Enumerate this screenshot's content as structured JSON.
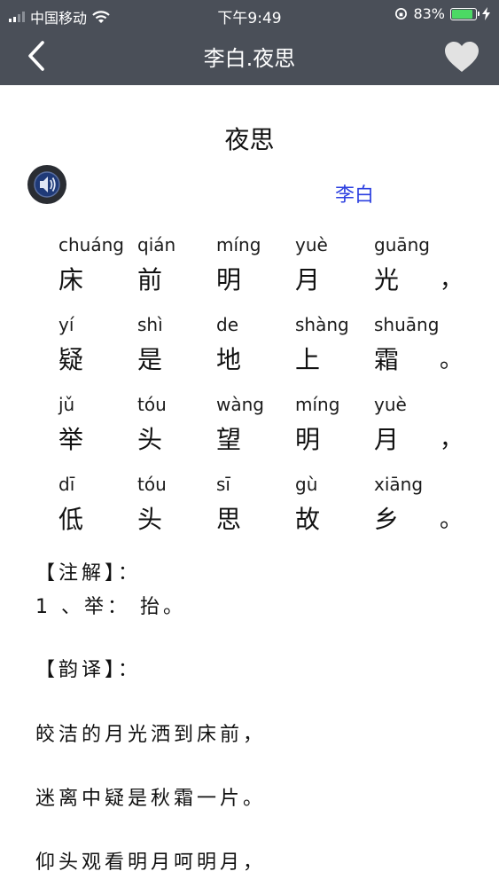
{
  "status_bar": {
    "carrier": "中国移动",
    "time": "下午9:49",
    "battery_percent": "83%"
  },
  "nav": {
    "title": "李白.夜思"
  },
  "poem": {
    "title": "夜思",
    "author": "李白",
    "lines": [
      {
        "chars": [
          [
            "chuáng",
            "床"
          ],
          [
            "qián",
            "前"
          ],
          [
            "míng",
            "明"
          ],
          [
            "yuè",
            "月"
          ],
          [
            "guāng",
            "光"
          ]
        ],
        "punct": "，"
      },
      {
        "chars": [
          [
            "yí",
            "疑"
          ],
          [
            "shì",
            "是"
          ],
          [
            "de",
            "地"
          ],
          [
            "shàng",
            "上"
          ],
          [
            "shuāng",
            "霜"
          ]
        ],
        "punct": "。"
      },
      {
        "chars": [
          [
            "jǔ",
            "举"
          ],
          [
            "tóu",
            "头"
          ],
          [
            "wàng",
            "望"
          ],
          [
            "míng",
            "明"
          ],
          [
            "yuè",
            "月"
          ]
        ],
        "punct": "，"
      },
      {
        "chars": [
          [
            "dī",
            "低"
          ],
          [
            "tóu",
            "头"
          ],
          [
            "sī",
            "思"
          ],
          [
            "gù",
            "故"
          ],
          [
            "xiāng",
            "乡"
          ]
        ],
        "punct": "。"
      }
    ]
  },
  "notes": {
    "heading": "【注解】：",
    "item1": "1 、举： 抬。"
  },
  "translation": {
    "heading": "【韵译】：",
    "lines": [
      "皎洁的月光洒到床前，",
      "迷离中疑是秋霜一片。",
      "仰头观看明月呵明月，"
    ]
  },
  "colors": {
    "header_bg": "#4a4f58",
    "author": "#2b3fe0",
    "battery": "#4cd964"
  }
}
